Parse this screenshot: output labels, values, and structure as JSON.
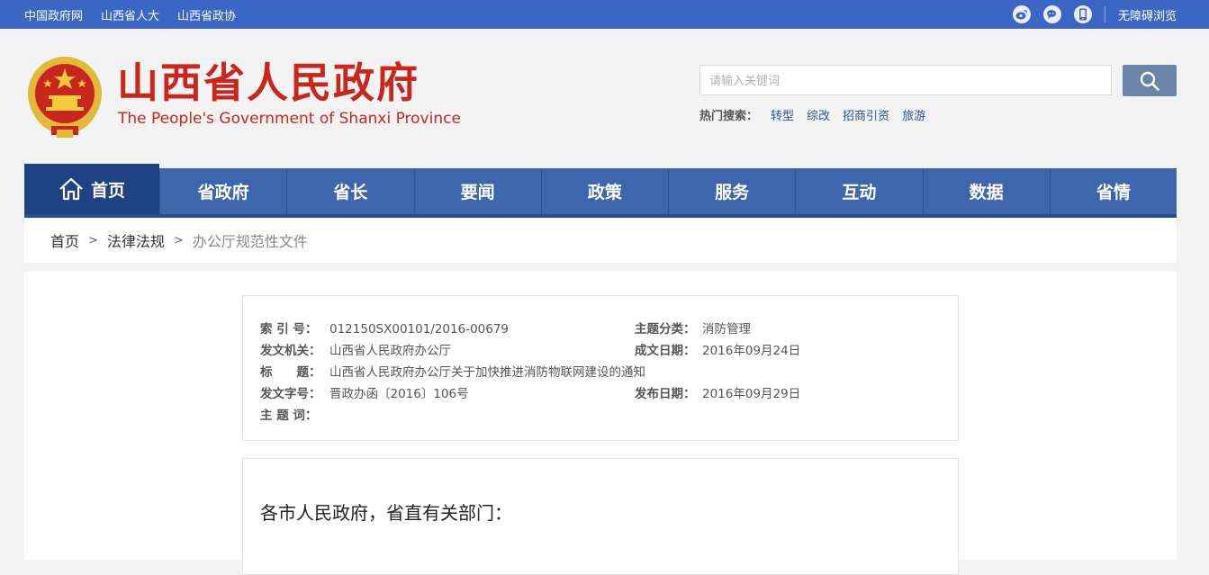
{
  "topbar": {
    "links": [
      "中国政府网",
      "山西省人大",
      "山西省政协"
    ],
    "icons": [
      "weibo-icon",
      "wechat-icon",
      "mobile-icon"
    ],
    "accessibility": "无障碍浏览"
  },
  "header": {
    "title": "山西省人民政府",
    "subtitle": "The People's Government of Shanxi Province"
  },
  "search": {
    "placeholder": "请输入关键词",
    "hot_label": "热门搜索：",
    "hot_terms": [
      "转型",
      "综改",
      "招商引资",
      "旅游"
    ]
  },
  "nav": {
    "home": "首页",
    "items": [
      "省政府",
      "省长",
      "要闻",
      "政策",
      "服务",
      "互动",
      "数据",
      "省情"
    ]
  },
  "breadcrumb": {
    "home": "首页",
    "section": "法律法规",
    "current": "办公厅规范性文件",
    "separator": ">"
  },
  "document": {
    "index_label": "索 引 号：",
    "index_value": "012150SX00101/2016-00679",
    "category_label": "主题分类：",
    "category_value": "消防管理",
    "issuer_label": "发文机关：",
    "issuer_value": "山西省人民政府办公厅",
    "created_label": "成文日期：",
    "created_value": "2016年09月24日",
    "title_label": "标　　题：",
    "title_value": "山西省人民政府办公厅关于加快推进消防物联网建设的通知",
    "docno_label": "发文字号：",
    "docno_value": "晋政办函〔2016〕106号",
    "published_label": "发布日期：",
    "published_value": "2016年09月29日",
    "keywords_label": "主 题 词："
  },
  "body": {
    "greeting": "各市人民政府，省直有关部门："
  }
}
